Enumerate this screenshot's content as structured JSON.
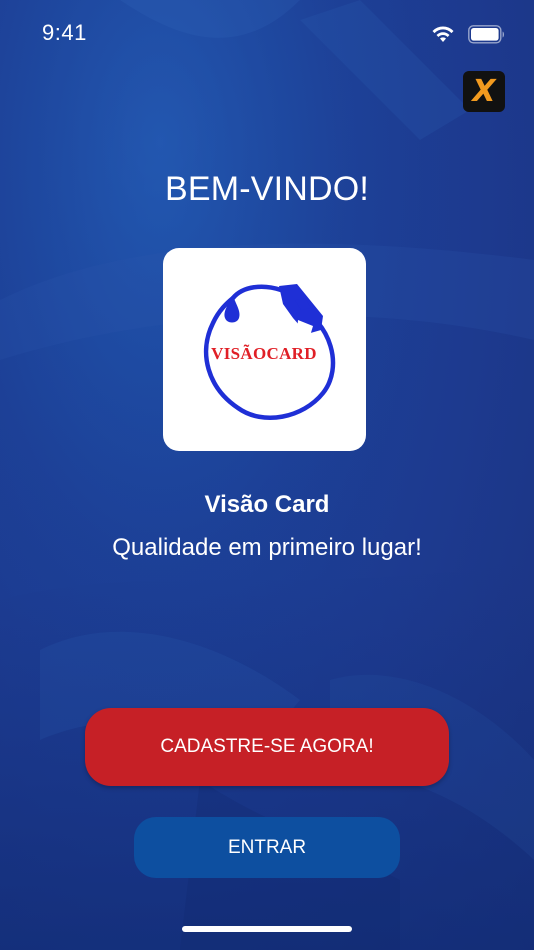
{
  "status_bar": {
    "time": "9:41"
  },
  "header": {
    "app_badge_letter": "X"
  },
  "welcome": {
    "title": "BEM-VINDO!"
  },
  "logo": {
    "text": "VISÃOCARD",
    "ring_color": "#1f2fd6",
    "text_color": "#e01f26"
  },
  "company": {
    "name": "Visão Card",
    "tagline": "Qualidade em primeiro lugar!"
  },
  "actions": {
    "register_label": "CADASTRE-SE AGORA!",
    "login_label": "ENTRAR"
  },
  "colors": {
    "background": "#1d3a8f",
    "register_button": "#c62026",
    "login_button": "#0d4fa0",
    "badge_accent": "#f29a1f"
  }
}
